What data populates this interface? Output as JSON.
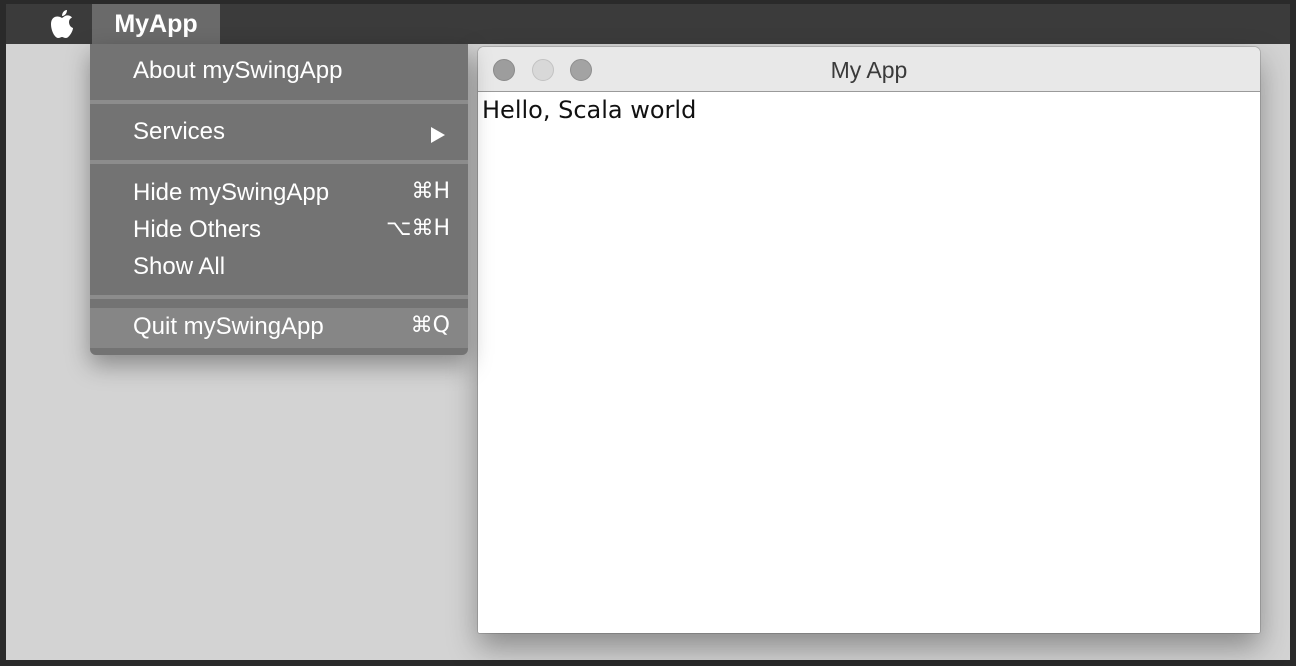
{
  "menubar": {
    "apple_icon": "apple-icon",
    "app_menu": "MyApp"
  },
  "app_menu_items": {
    "about": "About mySwingApp",
    "services": "Services",
    "services_arrow": "▶",
    "hide": "Hide mySwingApp",
    "hide_shortcut": "⌘H",
    "hide_others": "Hide Others",
    "hide_others_shortcut": "⌥⌘H",
    "show_all": "Show All",
    "quit": "Quit mySwingApp",
    "quit_shortcut": "⌘Q"
  },
  "window": {
    "title": "My App",
    "content_text": "Hello, Scala world"
  },
  "colors": {
    "menubar": "#3b3b3b",
    "menu_bg": "#737373",
    "highlight": "#868686",
    "desktop": "#d3d3d3"
  }
}
